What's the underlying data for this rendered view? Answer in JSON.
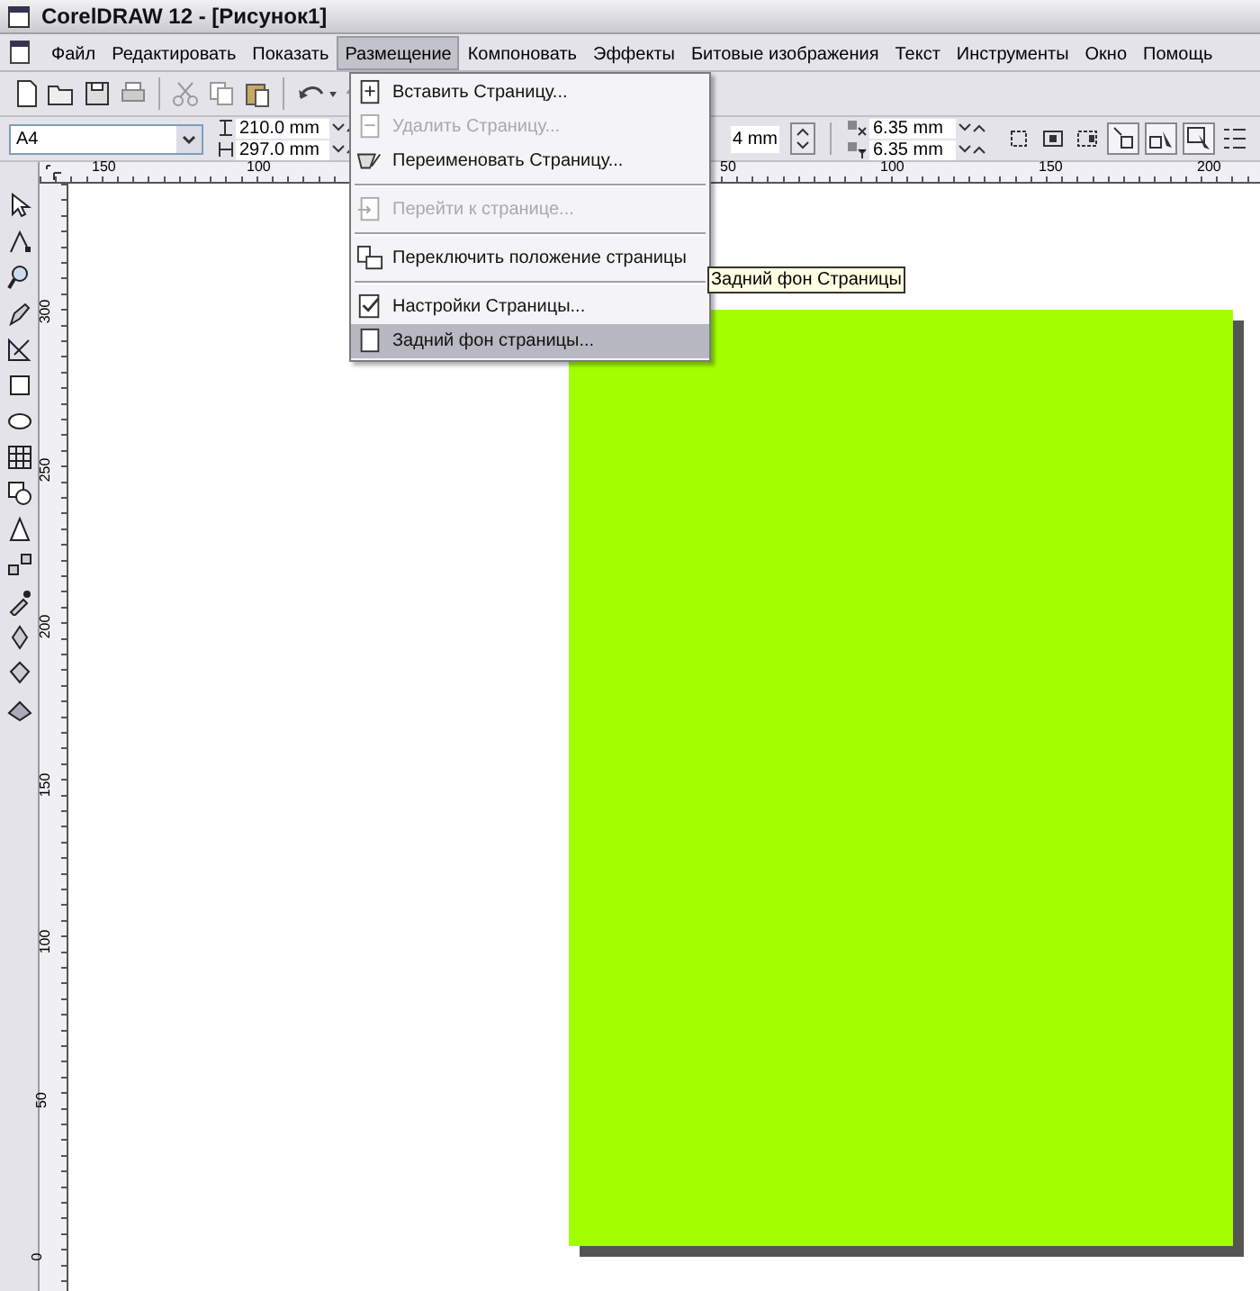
{
  "window": {
    "title": "CorelDRAW 12 - [Рисунок1]"
  },
  "menu_bar": [
    {
      "label": "Файл",
      "selected": false
    },
    {
      "label": "Редактировать",
      "selected": false
    },
    {
      "label": "Показать",
      "selected": false
    },
    {
      "label": "Размещение",
      "selected": true
    },
    {
      "label": "Компоновать",
      "selected": false
    },
    {
      "label": "Эффекты",
      "selected": false
    },
    {
      "label": "Битовые изображения",
      "selected": false
    },
    {
      "label": "Текст",
      "selected": false
    },
    {
      "label": "Инструменты",
      "selected": false
    },
    {
      "label": "Окно",
      "selected": false
    },
    {
      "label": "Помощь",
      "selected": false
    }
  ],
  "property_bar": {
    "paper_size": "A4",
    "width": "210.0 mm",
    "height": "297.0 mm",
    "partial_field": "4 mm",
    "nudge_x": "6.35 mm",
    "nudge_y": "6.35 mm"
  },
  "menu": {
    "items": [
      {
        "kind": "item",
        "label": "Вставить Страницу...",
        "disabled": false,
        "selected": false
      },
      {
        "kind": "item",
        "label": "Удалить Страницу...",
        "disabled": true,
        "selected": false
      },
      {
        "kind": "item",
        "label": "Переименовать Страницу...",
        "disabled": false,
        "selected": false
      },
      {
        "kind": "separator"
      },
      {
        "kind": "item",
        "label": "Перейти к странице...",
        "disabled": true,
        "selected": false
      },
      {
        "kind": "separator"
      },
      {
        "kind": "item",
        "label": "Переключить положение страницы",
        "disabled": false,
        "selected": false
      },
      {
        "kind": "separator"
      },
      {
        "kind": "item",
        "label": "Настройки Страницы...",
        "disabled": false,
        "selected": false
      },
      {
        "kind": "item",
        "label": "Задний фон страницы...",
        "disabled": false,
        "selected": true
      }
    ]
  },
  "tooltip": "Задний фон Страницы",
  "horizontal_ruler": [
    "150",
    "100",
    "50",
    "100",
    "150",
    "200"
  ],
  "vertical_ruler": [
    "300",
    "250",
    "200",
    "150",
    "100",
    "50",
    "0"
  ]
}
